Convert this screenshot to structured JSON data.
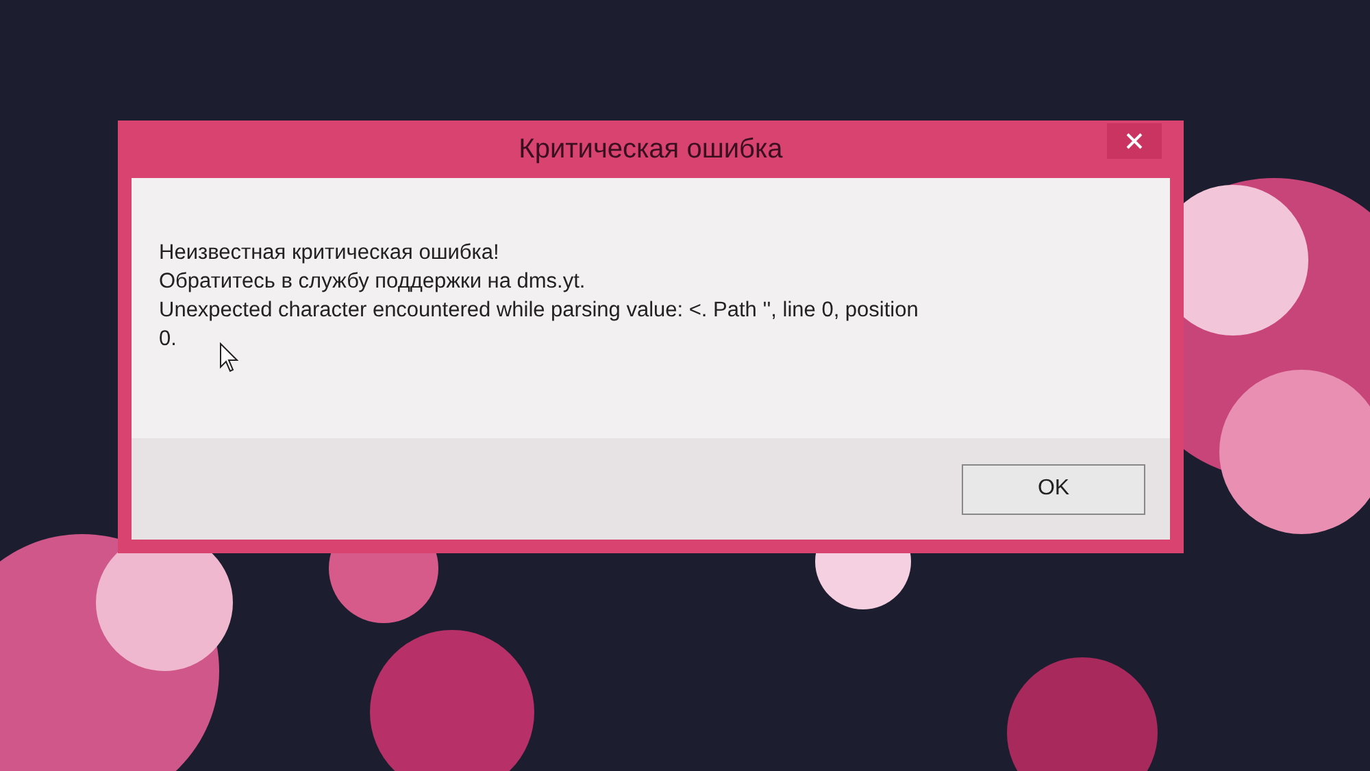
{
  "dialog": {
    "title": "Критическая ошибка",
    "message_lines": [
      "Неизвестная критическая ошибка!",
      "Обратитесь в службу поддержки на dms.yt.",
      "Unexpected character encountered while parsing value: <. Path '', line 0, position 0."
    ],
    "buttons": [
      {
        "label": "OK"
      }
    ]
  }
}
